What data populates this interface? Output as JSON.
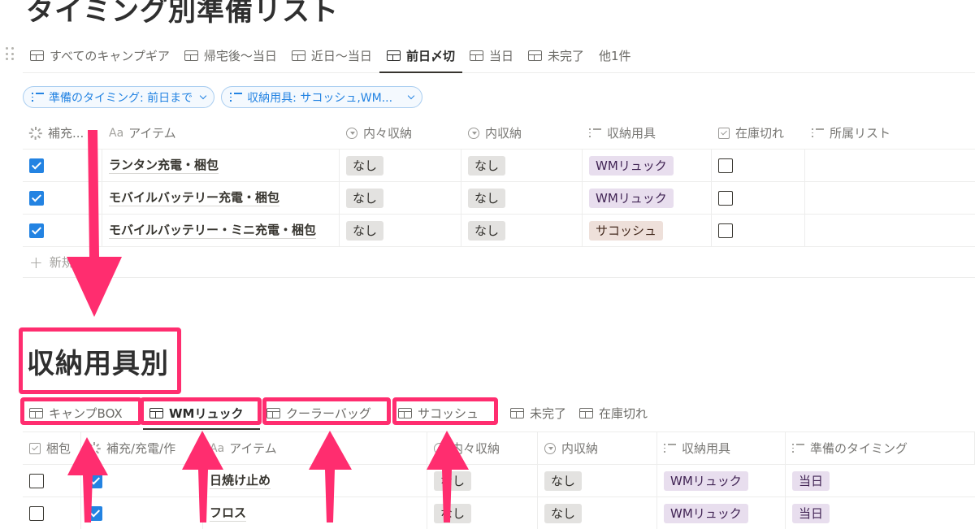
{
  "page": {
    "title": "タイミング別準備リスト"
  },
  "top_view": {
    "tabs": [
      {
        "label": "すべてのキャンプギア",
        "active": false
      },
      {
        "label": "帰宅後〜当日",
        "active": false
      },
      {
        "label": "近日〜当日",
        "active": false
      },
      {
        "label": "前日〆切",
        "active": true
      },
      {
        "label": "当日",
        "active": false
      },
      {
        "label": "未完了",
        "active": false
      }
    ],
    "more_label": "他1件",
    "filters": [
      {
        "label": "準備のタイミング: 前日まで"
      },
      {
        "label": "収納用具: サコッシュ,WM..."
      }
    ],
    "columns": [
      {
        "label": "補充...",
        "icon": "status-spinner-icon"
      },
      {
        "label": "アイテム",
        "icon": "title-aa-icon"
      },
      {
        "label": "内々収納",
        "icon": "select-circle-icon"
      },
      {
        "label": "内収納",
        "icon": "select-circle-icon"
      },
      {
        "label": "収納用具",
        "icon": "multiselect-list-icon"
      },
      {
        "label": "在庫切れ",
        "icon": "checkbox-icon"
      },
      {
        "label": "所属リスト",
        "icon": "multiselect-list-icon"
      }
    ],
    "rows": [
      {
        "replenished": true,
        "item": "ランタン充電・梱包",
        "inner_inner": "なし",
        "inner": "なし",
        "storage": "WMリュック",
        "storage_color": "purple",
        "out_of_stock": false,
        "list": ""
      },
      {
        "replenished": true,
        "item": "モバイルバッテリー充電・梱包",
        "inner_inner": "なし",
        "inner": "なし",
        "storage": "WMリュック",
        "storage_color": "purple",
        "out_of_stock": false,
        "list": ""
      },
      {
        "replenished": true,
        "item": "モバイルバッテリー・ミニ充電・梱包",
        "inner_inner": "なし",
        "inner": "なし",
        "storage": "サコッシュ",
        "storage_color": "brown",
        "out_of_stock": false,
        "list": ""
      }
    ],
    "new_label": "新規"
  },
  "bottom_view": {
    "title": "収納用具別",
    "tabs": [
      {
        "label": "キャンプBOX",
        "active": false,
        "highlighted": true
      },
      {
        "label": "WMリュック",
        "active": true,
        "highlighted": true
      },
      {
        "label": "クーラーバッグ",
        "active": false,
        "highlighted": true
      },
      {
        "label": "サコッシュ",
        "active": false,
        "highlighted": true
      },
      {
        "label": "未完了",
        "active": false,
        "highlighted": false
      },
      {
        "label": "在庫切れ",
        "active": false,
        "highlighted": false
      }
    ],
    "columns": [
      {
        "label": "梱包",
        "icon": "checkbox-icon"
      },
      {
        "label": "補充/充電/作",
        "icon": "status-spinner-icon"
      },
      {
        "label": "アイテム",
        "icon": "title-aa-icon"
      },
      {
        "label": "内々収納",
        "icon": "select-circle-icon"
      },
      {
        "label": "内収納",
        "icon": "select-circle-icon"
      },
      {
        "label": "収納用具",
        "icon": "multiselect-list-icon"
      },
      {
        "label": "準備のタイミング",
        "icon": "multiselect-list-icon"
      }
    ],
    "rows": [
      {
        "packed": false,
        "replenished": true,
        "item": "日焼け止め",
        "inner_inner": "なし",
        "inner": "なし",
        "storage": "WMリュック",
        "timing": "当日"
      },
      {
        "packed": false,
        "replenished": true,
        "item": "フロス",
        "inner_inner": "なし",
        "inner": "なし",
        "storage": "WMリュック",
        "timing": "当日"
      }
    ]
  },
  "annotation": {
    "color": "#ff2d6f"
  },
  "colors": {
    "accent_blue": "#2383e2",
    "tag_gray": "#e3e2e0",
    "tag_purple": "#e8deee",
    "tag_brown": "#eee0da"
  }
}
